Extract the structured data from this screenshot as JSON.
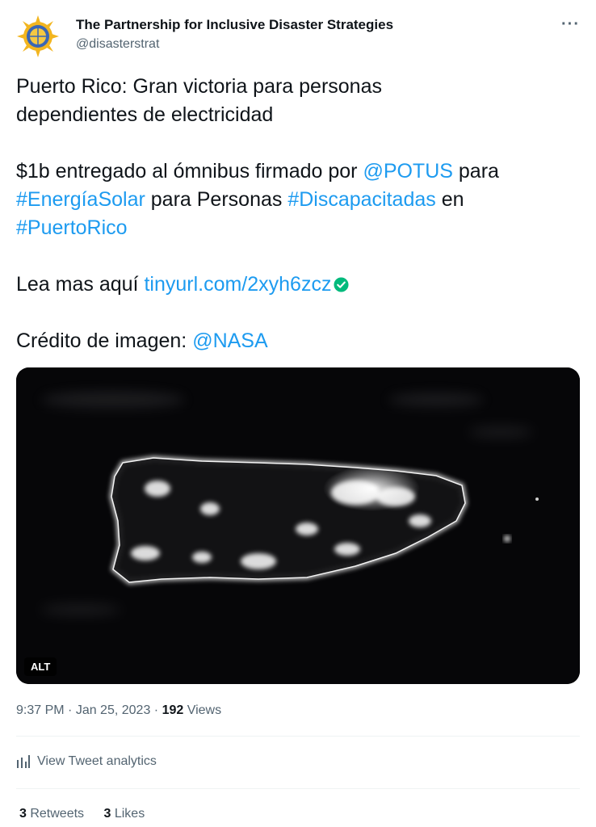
{
  "author": {
    "display_name": "The Partnership for Inclusive Disaster Strategies",
    "handle": "@disasterstrat",
    "avatar_icon": "sun-logo-icon"
  },
  "more_label": "···",
  "tweet": {
    "line1": "Puerto Rico: Gran victoria para personas dependientes de electricidad",
    "p2_a": "$1b entregado al ómnibus firmado por ",
    "p2_mention": "@POTUS",
    "p2_b": " para ",
    "p2_tag1": "#EnergíaSolar",
    "p2_c": " para Personas ",
    "p2_tag2": "#Discapacitadas",
    "p2_d": " en ",
    "p2_tag3": "#PuertoRico",
    "p3_a": "Lea mas aquí ",
    "p3_link": "tinyurl.com/2xyh6zcz",
    "p4_a": "Crédito de imagen: ",
    "p4_mention": "@NASA"
  },
  "media": {
    "alt_label": "ALT"
  },
  "meta": {
    "time": "9:37 PM",
    "sep1": " · ",
    "date": "Jan 25, 2023",
    "sep2": " · ",
    "views_count": "192",
    "views_label": " Views"
  },
  "analytics_label": "View Tweet analytics",
  "stats": {
    "retweets_count": "3",
    "retweets_label": " Retweets",
    "likes_count": "3",
    "likes_label": " Likes"
  },
  "colors": {
    "link": "#1d9bf0",
    "text": "#0f1419",
    "secondary": "#536471",
    "verified_check": "#00ba7c"
  }
}
